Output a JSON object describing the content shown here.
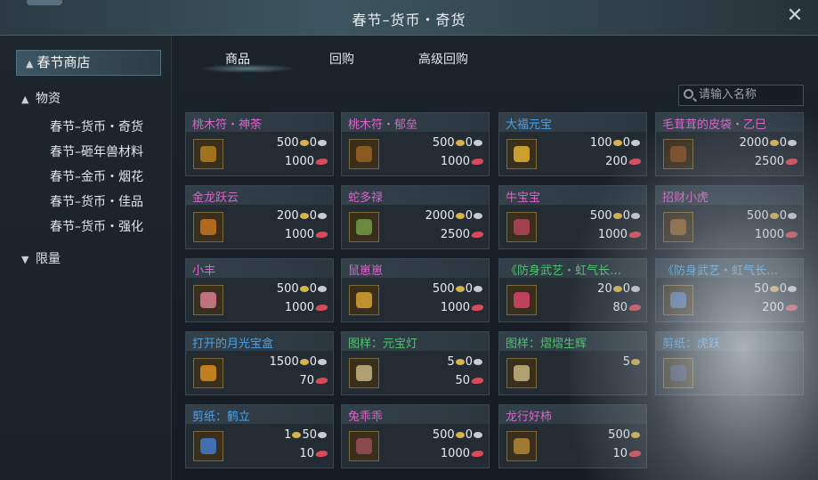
{
  "window": {
    "title": "春节–货币・奇货",
    "close_symbol": "✕"
  },
  "sidebar": {
    "header": "春节商店",
    "categories": [
      {
        "label": "物资",
        "expanded": true
      },
      {
        "label": "限量",
        "expanded": false
      }
    ],
    "subitems": [
      "春节–货币・奇货",
      "春节–砸年兽材料",
      "春节–金币・烟花",
      "春节–货币・佳品",
      "春节–货币・强化"
    ]
  },
  "tabs": [
    "商品",
    "回购",
    "高级回购"
  ],
  "search": {
    "placeholder": "请输入名称"
  },
  "items": [
    {
      "name": "桃木符・神荼",
      "price1": "500",
      "price2": "1000",
      "color": "pink",
      "sub": "0"
    },
    {
      "name": "桃木符・郁垒",
      "price1": "500",
      "price2": "1000",
      "color": "pink",
      "sub": "0"
    },
    {
      "name": "大福元宝",
      "price1": "100",
      "price2": "200",
      "color": "blue",
      "sub": "0"
    },
    {
      "name": "毛茸茸的皮袋・乙巳",
      "price1": "2000",
      "price2": "2500",
      "color": "pink",
      "sub": "0"
    },
    {
      "name": "金龙跃云",
      "price1": "200",
      "price2": "1000",
      "color": "pink",
      "sub": "0"
    },
    {
      "name": "蛇多禄",
      "price1": "2000",
      "price2": "2500",
      "color": "pink",
      "sub": "0"
    },
    {
      "name": "牛宝宝",
      "price1": "500",
      "price2": "1000",
      "color": "pink",
      "sub": "0"
    },
    {
      "name": "招财小虎",
      "price1": "500",
      "price2": "1000",
      "color": "pink",
      "sub": "0"
    },
    {
      "name": "小丰",
      "price1": "500",
      "price2": "1000",
      "color": "pink",
      "sub": "0"
    },
    {
      "name": "鼠崽崽",
      "price1": "500",
      "price2": "1000",
      "color": "pink",
      "sub": "0"
    },
    {
      "name": "《防身武艺・虹气长…",
      "price1": "20",
      "price2": "80",
      "color": "green",
      "sub": "0"
    },
    {
      "name": "《防身武艺・虹气长…",
      "price1": "50",
      "price2": "200",
      "color": "blue",
      "sub": "0"
    },
    {
      "name": "打开的月光宝盒",
      "price1": "1500",
      "price2": "70",
      "color": "blue",
      "sub": "0"
    },
    {
      "name": "图样：元宝灯",
      "price1": "5",
      "price2": "50",
      "color": "green",
      "sub": "0"
    },
    {
      "name": "图样：熠熠生辉",
      "price1": "5",
      "price2": "",
      "color": "green",
      "sub": ""
    },
    {
      "name": "剪纸：虎跃",
      "price1": "",
      "price2": "",
      "color": "blue",
      "sub": ""
    },
    {
      "name": "剪纸：鹤立",
      "price1": "1",
      "price2": "10",
      "color": "blue",
      "sub": "50"
    },
    {
      "name": "兔乖乖",
      "price1": "500",
      "price2": "1000",
      "color": "pink",
      "sub": "0"
    },
    {
      "name": "龙行好柿",
      "price1": "500",
      "price2": "10",
      "color": "pink",
      "sub": ""
    }
  ],
  "colors": {
    "pink": "#d864c9",
    "blue": "#4aa0e6",
    "green": "#4cc46b",
    "gold_coin": "#d9b24a",
    "red_gem": "#d64a5a"
  }
}
